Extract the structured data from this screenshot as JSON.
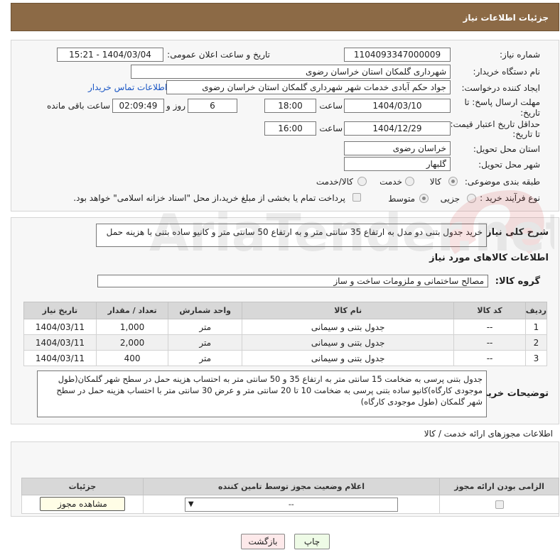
{
  "header": {
    "title": "جزئیات اطلاعات نیاز"
  },
  "form": {
    "need_number_label": "شماره نیاز:",
    "need_number": "1104093347000009",
    "announce_label": "تاریخ و ساعت اعلان عمومی:",
    "announce_value": "1404/03/04 - 15:21",
    "buyer_org_label": "نام دستگاه خریدار:",
    "buyer_org": "شهرداری گلمکان استان خراسان رضوی",
    "requester_label": "ایجاد کننده درخواست:",
    "requester": "جواد حکم آبادی خدمات شهر شهرداری گلمکان استان خراسان رضوی",
    "contact_link": "اطلاعات تماس خریدار",
    "deadline_label_1": "مهلت ارسال پاسخ: تا",
    "deadline_label_2": "تاریخ:",
    "deadline_date": "1404/03/10",
    "time_label": "ساعت",
    "deadline_time": "18:00",
    "days_value": "6",
    "days_label": "روز و",
    "remaining_time": "02:09:49",
    "remaining_label": "ساعت باقی مانده",
    "validity_label_1": "حداقل تاریخ اعتبار قیمت:",
    "validity_label_2": "تا تاریخ:",
    "validity_date": "1404/12/29",
    "validity_time": "16:00",
    "province_label": "استان محل تحویل:",
    "province": "خراسان رضوی",
    "city_label": "شهر محل تحویل:",
    "city": "گلبهار",
    "category_label": "طبقه بندی موضوعی:",
    "category_options": [
      "کالا",
      "خدمت",
      "کالا/خدمت"
    ],
    "category_selected": "کالا",
    "process_label": "نوع فرآیند خرید :",
    "process_options": [
      "جزیی",
      "متوسط"
    ],
    "payment_note": "پرداخت تمام یا بخشی از مبلغ خرید،از محل \"اسناد خزانه اسلامی\" خواهد بود."
  },
  "description": {
    "label": "شرح کلی نیاز:",
    "text": "خرید جدول بتنی دو مدل به ارتفاع 35 سانتی متر و به ارتفاع 50 سانتی متر و کانیو ساده بتنی با هزینه حمل"
  },
  "goods": {
    "section_title": "اطلاعات کالاهای مورد نیاز",
    "group_label": "گروه کالا:",
    "group_value": "مصالح ساختمانی و ملزومات ساخت و ساز",
    "columns": [
      "ردیف",
      "کد کالا",
      "نام کالا",
      "واحد شمارش",
      "تعداد / مقدار",
      "تاریخ نیاز"
    ],
    "rows": [
      {
        "idx": "1",
        "code": "--",
        "name": "جدول بتنی و سیمانی",
        "unit": "متر",
        "qty": "1,000",
        "date": "1404/03/11"
      },
      {
        "idx": "2",
        "code": "--",
        "name": "جدول بتنی و سیمانی",
        "unit": "متر",
        "qty": "2,000",
        "date": "1404/03/11"
      },
      {
        "idx": "3",
        "code": "--",
        "name": "جدول بتنی و سیمانی",
        "unit": "متر",
        "qty": "400",
        "date": "1404/03/11"
      }
    ],
    "notes_label": "توضیحات خریدار:",
    "notes_text": "جدول بتنی پرسی به ضخامت 15 سانتی متر به ارتفاع 35 و 50 سانتی متر به احتساب هزینه حمل در سطح شهر گلمکان(طول موجودی کارگاه)کانیو ساده بتنی پرسی به ضخامت 10 تا 20 سانتی متر و عرض 30 سانتی متر با احتساب هزینه حمل در سطح شهر گلمکان (طول موجودی کارگاه)"
  },
  "permits": {
    "section_title": "اطلاعات مجوزهای ارائه خدمت / کالا",
    "columns": [
      "الزامی بودن ارائه مجوز",
      "اعلام وضعیت مجوز توسط تامین کننده",
      "جزئیات"
    ],
    "status_value": "--",
    "view_button": "مشاهده مجوز"
  },
  "footer": {
    "print_button": "چاپ",
    "back_button": "بازگشت"
  },
  "watermark": {
    "text": "AriaTender.net"
  },
  "colors": {
    "header_bg": "#8c6a46",
    "link": "#1a56c4",
    "print_bg": "#eefbe6",
    "back_bg": "#fde9ea"
  }
}
